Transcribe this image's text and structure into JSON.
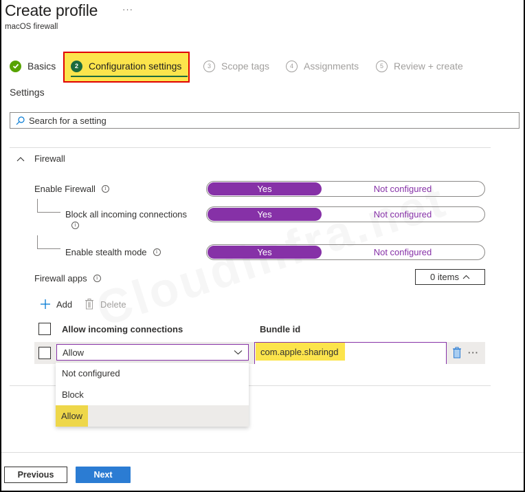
{
  "header": {
    "title": "Create profile",
    "more_label": "···",
    "subtitle": "macOS firewall"
  },
  "wizard": {
    "steps": [
      {
        "number": "",
        "label": "Basics",
        "state": "done"
      },
      {
        "number": "2",
        "label": "Configuration settings",
        "state": "current"
      },
      {
        "number": "3",
        "label": "Scope tags",
        "state": "pending"
      },
      {
        "number": "4",
        "label": "Assignments",
        "state": "pending"
      },
      {
        "number": "5",
        "label": "Review + create",
        "state": "pending"
      }
    ]
  },
  "settings": {
    "heading": "Settings",
    "search_placeholder": "Search for a setting"
  },
  "firewall": {
    "section_title": "Firewall",
    "rows": [
      {
        "label": "Enable Firewall",
        "yes_label": "Yes",
        "nc_label": "Not configured",
        "selected": "Yes"
      },
      {
        "label": "Block all incoming connections",
        "yes_label": "Yes",
        "nc_label": "Not configured",
        "selected": "Yes"
      },
      {
        "label": "Enable stealth mode",
        "yes_label": "Yes",
        "nc_label": "Not configured",
        "selected": "Yes"
      }
    ],
    "apps": {
      "label": "Firewall apps",
      "items_button": "0 items",
      "add_label": "Add",
      "delete_label": "Delete",
      "columns": [
        "Allow incoming connections",
        "Bundle id"
      ],
      "row": {
        "allow_value": "Allow",
        "bundle_id": "com.apple.sharingd"
      },
      "dropdown_options": [
        "Not configured",
        "Block",
        "Allow"
      ],
      "dropdown_selected": "Allow"
    }
  },
  "footer": {
    "previous_label": "Previous",
    "next_label": "Next"
  },
  "watermark": "Cloudinfra.net",
  "colors": {
    "accent_purple": "#8631a7",
    "primary_blue": "#2b7cd3",
    "highlight_yellow": "#fce44c",
    "annotation_red": "#e00000",
    "step_done_green": "#57a300"
  }
}
